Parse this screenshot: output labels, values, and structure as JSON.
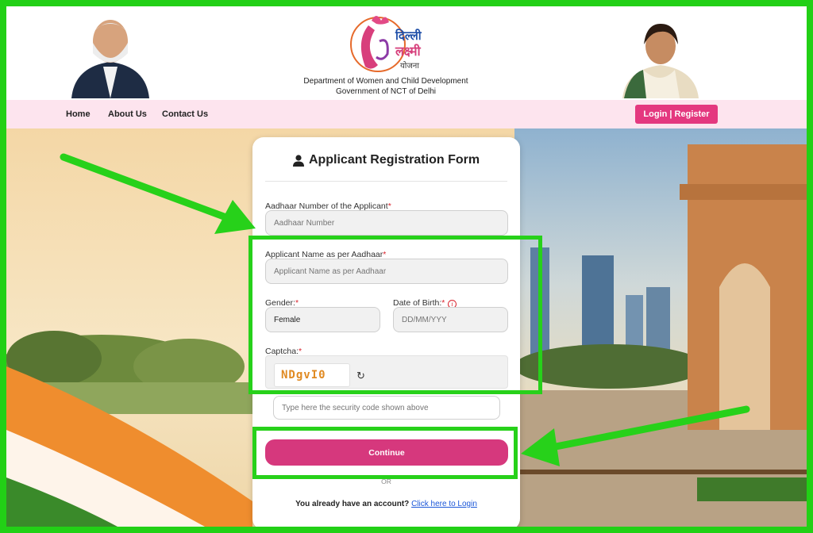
{
  "header": {
    "logo_text_line1": "दिल्ली",
    "logo_text_line2": "लक्ष्मी",
    "logo_text_line3": "योजना",
    "dept_line1": "Department of Women and Child Development",
    "dept_line2": "Government of NCT of Delhi"
  },
  "nav": {
    "items": [
      {
        "label": "Home"
      },
      {
        "label": "About Us"
      },
      {
        "label": "Contact Us"
      }
    ],
    "login_label": "Login | Register"
  },
  "form": {
    "title": "Applicant Registration Form",
    "title_icon": "user-icon",
    "aadhaar": {
      "label": "Aadhaar Number of the Applicant",
      "placeholder": "Aadhaar Number"
    },
    "name": {
      "label": "Applicant Name as per Aadhaar",
      "placeholder": "Applicant Name as per Aadhaar"
    },
    "gender": {
      "label": "Gender:",
      "value": "Female"
    },
    "dob": {
      "label": "Date of Birth:",
      "placeholder": "DD/MM/YYY"
    },
    "captcha": {
      "label": "Captcha:",
      "code": "NDgvI0",
      "input_placeholder": "Type here the security code shown above"
    },
    "required_mark": "*",
    "continue_label": "Continue",
    "or_text": "OR",
    "already_text": "You already have an account?",
    "login_link": "Click here to Login"
  },
  "colors": {
    "accent_pink": "#e4387f",
    "highlight_green": "#27d11a",
    "nav_bg": "#fde4ee"
  }
}
